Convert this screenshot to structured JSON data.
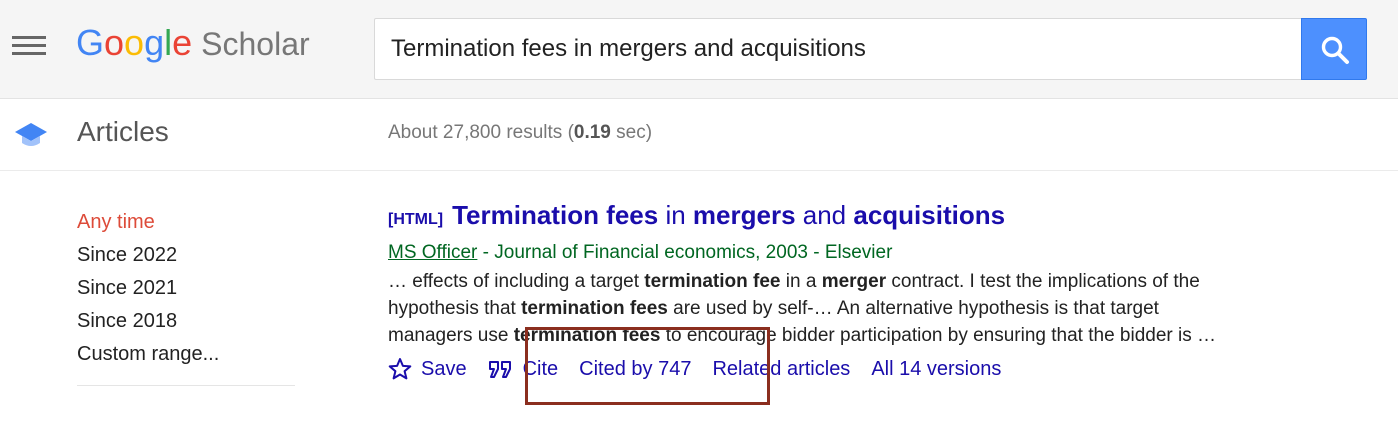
{
  "header": {
    "logo_google": [
      "G",
      "o",
      "o",
      "g",
      "l",
      "e"
    ],
    "logo_scholar": "Scholar",
    "search_value": "Termination fees in mergers and acquisitions",
    "menu_icon": "hamburger-menu-icon",
    "search_icon": "search-icon"
  },
  "subheader": {
    "section_label": "Articles",
    "stats_prefix": "About 27,800 results (",
    "stats_time": "0.19",
    "stats_suffix": " sec)",
    "section_icon": "graduation-cap-icon"
  },
  "sidebar": {
    "items": [
      {
        "label": "Any time",
        "active": true
      },
      {
        "label": "Since 2022",
        "active": false
      },
      {
        "label": "Since 2021",
        "active": false
      },
      {
        "label": "Since 2018",
        "active": false
      },
      {
        "label": "Custom range...",
        "active": false
      }
    ]
  },
  "result": {
    "type_tag": "[HTML]",
    "title_parts": [
      {
        "text": "Termination fees",
        "bold": true
      },
      {
        "text": " in ",
        "bold": false
      },
      {
        "text": "mergers",
        "bold": true
      },
      {
        "text": " and ",
        "bold": false
      },
      {
        "text": "acquisitions",
        "bold": true
      }
    ],
    "author": "MS Officer",
    "source": " - Journal of Financial economics, 2003 - Elsevier",
    "snippet_lines": [
      [
        {
          "text": "… effects of including a target ",
          "bold": false
        },
        {
          "text": "termination fee",
          "bold": true
        },
        {
          "text": " in a ",
          "bold": false
        },
        {
          "text": "merger",
          "bold": true
        },
        {
          "text": " contract. I test the implications of the",
          "bold": false
        }
      ],
      [
        {
          "text": "hypothesis that ",
          "bold": false
        },
        {
          "text": "termination fees",
          "bold": true
        },
        {
          "text": " are used by self-… An alternative hypothesis is that target",
          "bold": false
        }
      ],
      [
        {
          "text": "managers use ",
          "bold": false
        },
        {
          "text": "termination fees",
          "bold": true
        },
        {
          "text": " to encourage bidder participation by ensuring that the bidder is …",
          "bold": false
        }
      ]
    ],
    "actions": {
      "save": "Save",
      "cite": "Cite",
      "cited_by": "Cited by 747",
      "related": "Related articles",
      "versions": "All 14 versions",
      "save_icon": "star-icon",
      "cite_icon": "quote-icon"
    }
  },
  "colors": {
    "link": "#1a0dab",
    "author_green": "#006621",
    "active_red": "#dd4b39",
    "search_button": "#4d90fe",
    "highlight_box": "#8b2e1f"
  }
}
